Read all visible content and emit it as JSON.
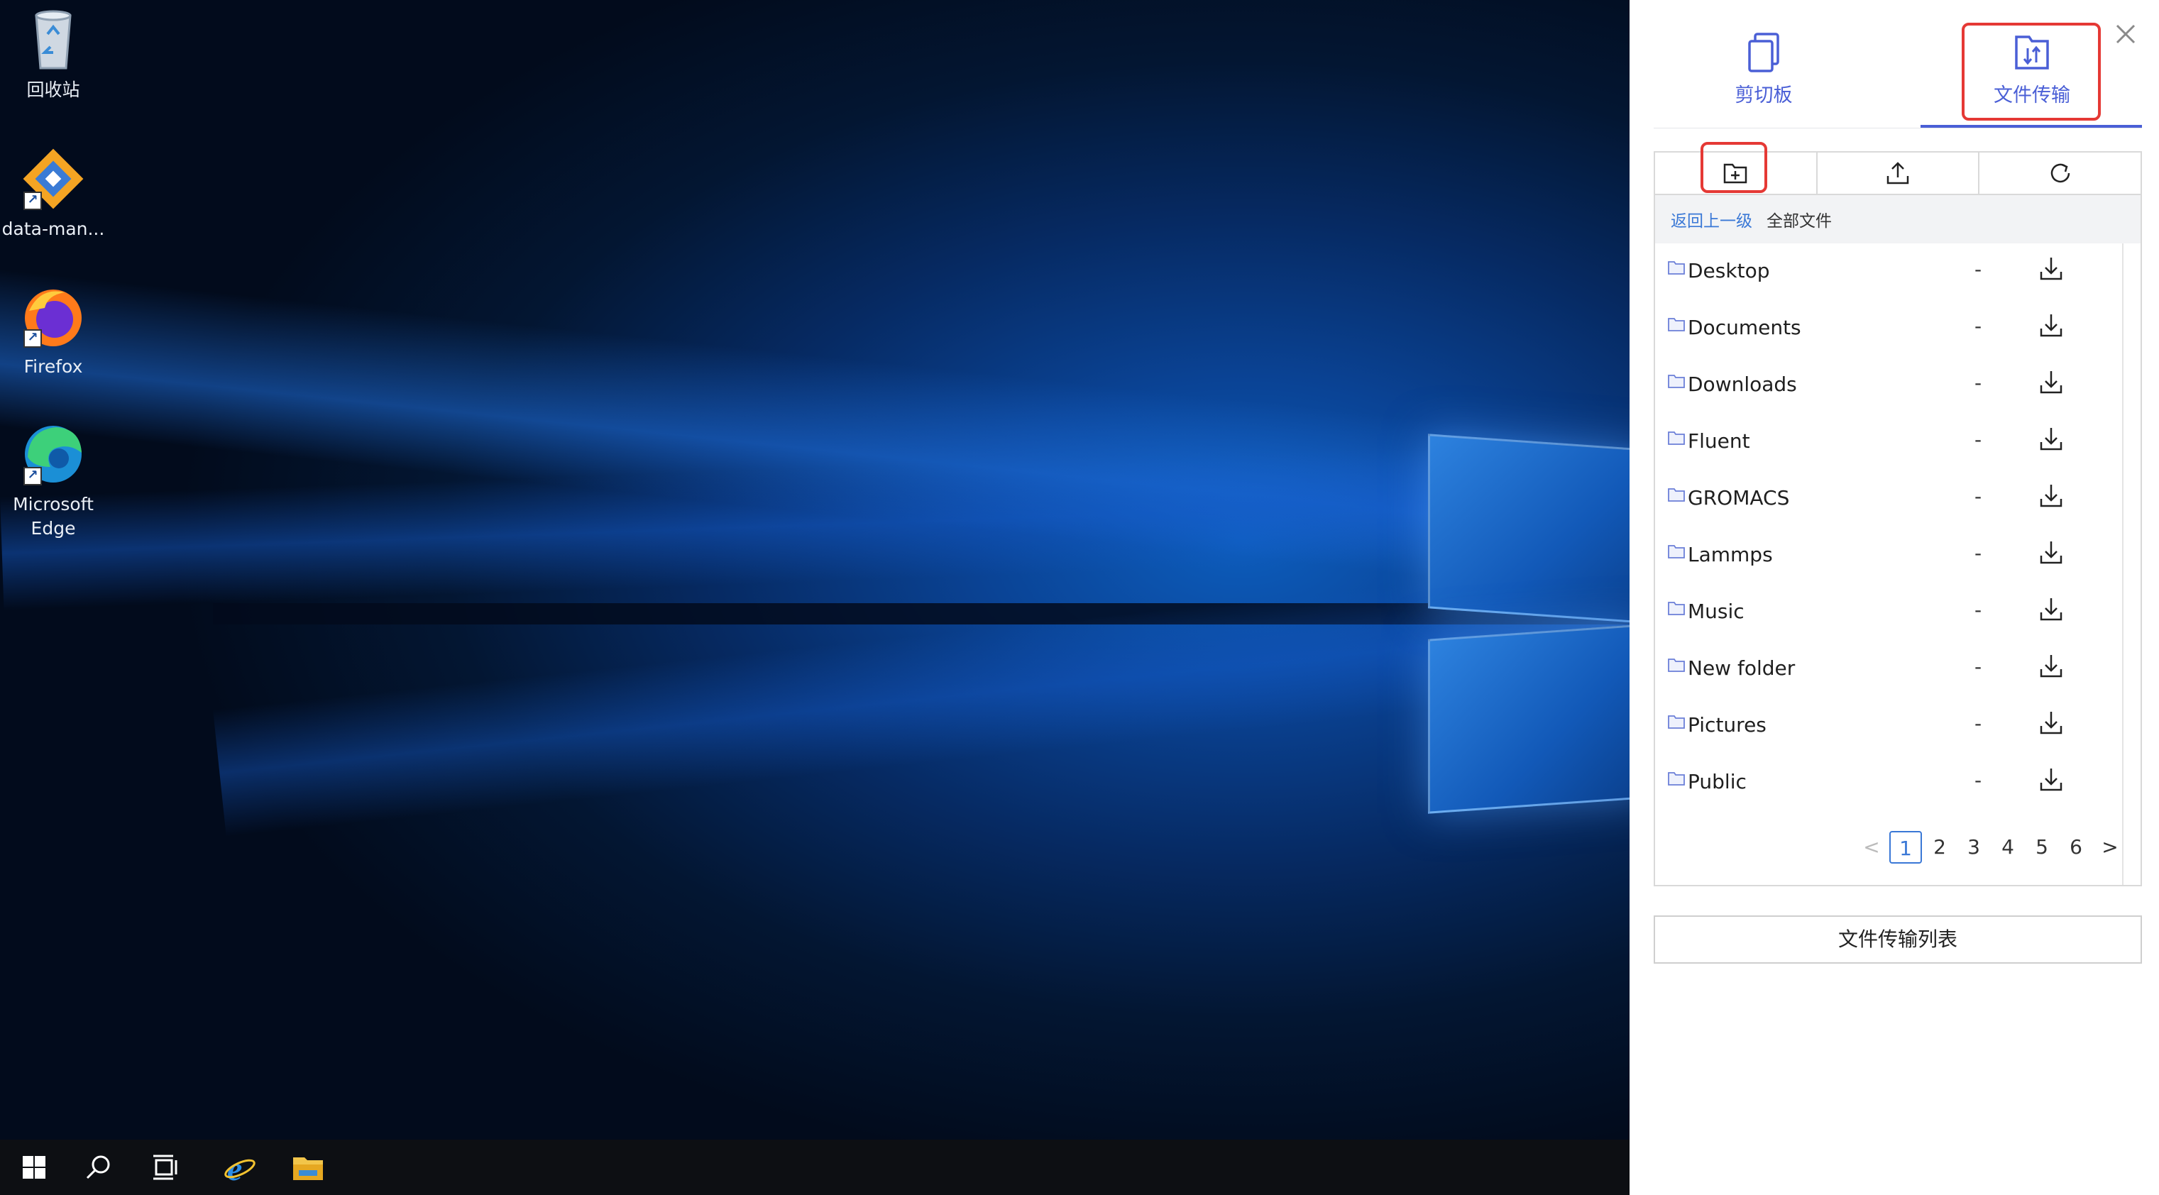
{
  "desktop": {
    "icons": [
      {
        "label": "回收站",
        "icon": "recycle-bin-icon"
      },
      {
        "label": "data-man...",
        "icon": "data-manager-icon"
      },
      {
        "label": "Firefox",
        "icon": "firefox-icon"
      },
      {
        "label": "Microsoft Edge",
        "icon": "edge-icon"
      }
    ]
  },
  "taskbar": {
    "items": [
      "start-icon",
      "search-icon",
      "task-view-icon",
      "internet-explorer-icon",
      "file-explorer-icon"
    ]
  },
  "panel": {
    "tabs": [
      {
        "label": "剪切板",
        "icon": "clipboard-icon"
      },
      {
        "label": "文件传输",
        "icon": "file-transfer-icon",
        "active": true
      }
    ],
    "toolbar": [
      "new-folder-icon",
      "upload-icon",
      "refresh-icon"
    ],
    "breadcrumb": {
      "back": "返回上一级",
      "current": "全部文件"
    },
    "files": [
      {
        "name": "Desktop",
        "size": "-"
      },
      {
        "name": "Documents",
        "size": "-"
      },
      {
        "name": "Downloads",
        "size": "-"
      },
      {
        "name": "Fluent",
        "size": "-"
      },
      {
        "name": "GROMACS",
        "size": "-"
      },
      {
        "name": "Lammps",
        "size": "-"
      },
      {
        "name": "Music",
        "size": "-"
      },
      {
        "name": "New folder",
        "size": "-"
      },
      {
        "name": "Pictures",
        "size": "-"
      },
      {
        "name": "Public",
        "size": "-"
      }
    ],
    "pagination": {
      "prev": "<",
      "pages": [
        "1",
        "2",
        "3",
        "4",
        "5",
        "6"
      ],
      "current": "1",
      "next": ">"
    },
    "transfer_list_button": "文件传输列表",
    "accent_color": "#4a5fd6",
    "highlight_color": "#e53935"
  }
}
